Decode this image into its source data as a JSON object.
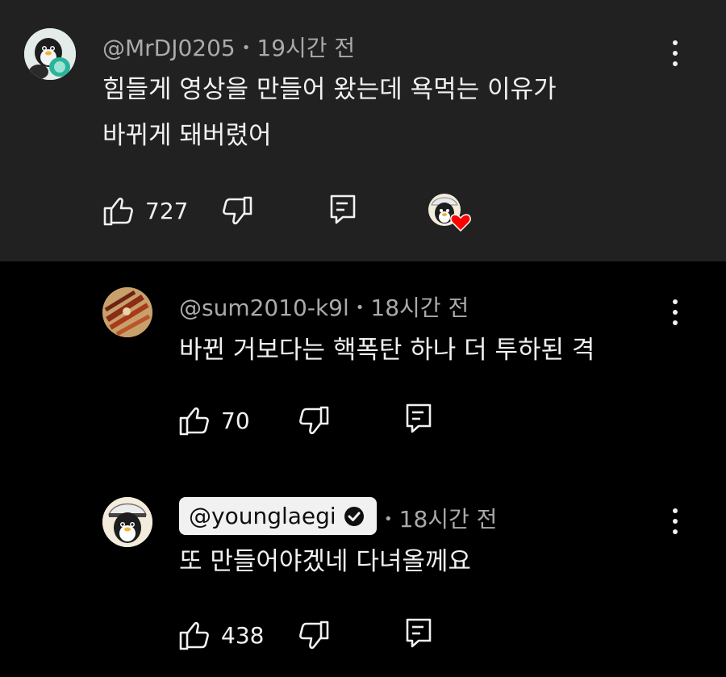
{
  "comments": [
    {
      "handle": "@MrDJ0205",
      "time": "19시간 전",
      "lines": [
        "힘들게 영상을 만들어 왔는데 욕먹는 이유가",
        "바뀌게 돼버렸어"
      ],
      "likes": "727",
      "creator_heart": true
    },
    {
      "handle": "@sum2010-k9l",
      "time": "18시간 전",
      "lines": [
        "바뀐 거보다는 핵폭탄 하나 더 투하된 격"
      ],
      "likes": "70"
    },
    {
      "handle": "@younglaegi",
      "time": "18시간 전",
      "lines": [
        "또 만들어야겠네 다녀올께요"
      ],
      "likes": "438",
      "verified": true
    }
  ],
  "icons": {
    "like": "thumbs-up-icon",
    "dislike": "thumbs-down-icon",
    "reply": "reply-icon",
    "more": "more-vert-icon",
    "verified": "verified-check-icon",
    "heart": "creator-heart-icon"
  },
  "colors": {
    "top_background": "#212121",
    "reply_background": "#000000",
    "text": "#f1f1f1",
    "meta": "#aaaaaa",
    "heart": "#ff0000",
    "badge_background": "#f1f1f1"
  }
}
